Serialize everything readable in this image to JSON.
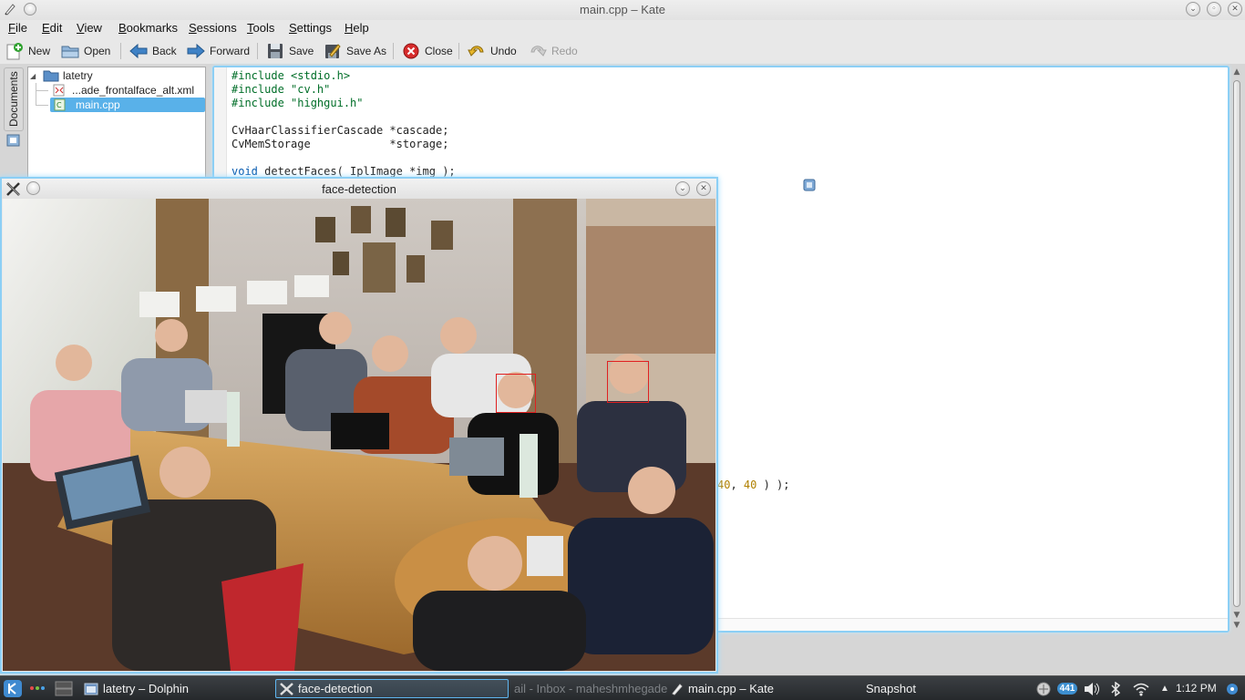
{
  "kate": {
    "title": "main.cpp – Kate",
    "menu": [
      "File",
      "Edit",
      "View",
      "Bookmarks",
      "Sessions",
      "Tools",
      "Settings",
      "Help"
    ],
    "toolbar": {
      "new": "New",
      "open": "Open",
      "back": "Back",
      "forward": "Forward",
      "save": "Save",
      "save_as": "Save As",
      "close": "Close",
      "undo": "Undo",
      "redo": "Redo"
    },
    "sidetab": "Documents",
    "documents": {
      "folder": "latetry",
      "files": [
        {
          "name": "...ade_frontalface_alt.xml",
          "selected": false
        },
        {
          "name": "main.cpp",
          "selected": true
        }
      ]
    },
    "code": {
      "line1": "#include <stdio.h>",
      "line2": "#include \"cv.h\"",
      "line3": "#include \"highgui.h\"",
      "line5": "CvHaarClassifierCascade *cascade;",
      "line6": "CvMemStorage            *storage;",
      "line8_kw": "void",
      "line8_rest": " detectFaces( IplImage *img );",
      "tail_num1": "40",
      "tail_sep": ", ",
      "tail_num2": "40",
      "tail_end": " ) );"
    }
  },
  "face_window": {
    "title": "face-detection",
    "detected_faces": 2
  },
  "taskbar": {
    "tasks": [
      {
        "label": "latetry – Dolphin",
        "active": false
      },
      {
        "label": "face-detection",
        "active": true
      },
      {
        "label": "ail - Inbox - maheshmhegade@gi",
        "active": false
      },
      {
        "label": "main.cpp – Kate",
        "active": false
      },
      {
        "label": "Snapshot",
        "active": false
      }
    ],
    "badge": "441",
    "clock": "1:12 PM"
  },
  "colors": {
    "selection": "#59b1e9",
    "focus_border": "#8ccff5",
    "face_box": "#e02020",
    "preprocessor": "#006e28",
    "keyword": "#0057ae",
    "number": "#b08000"
  }
}
